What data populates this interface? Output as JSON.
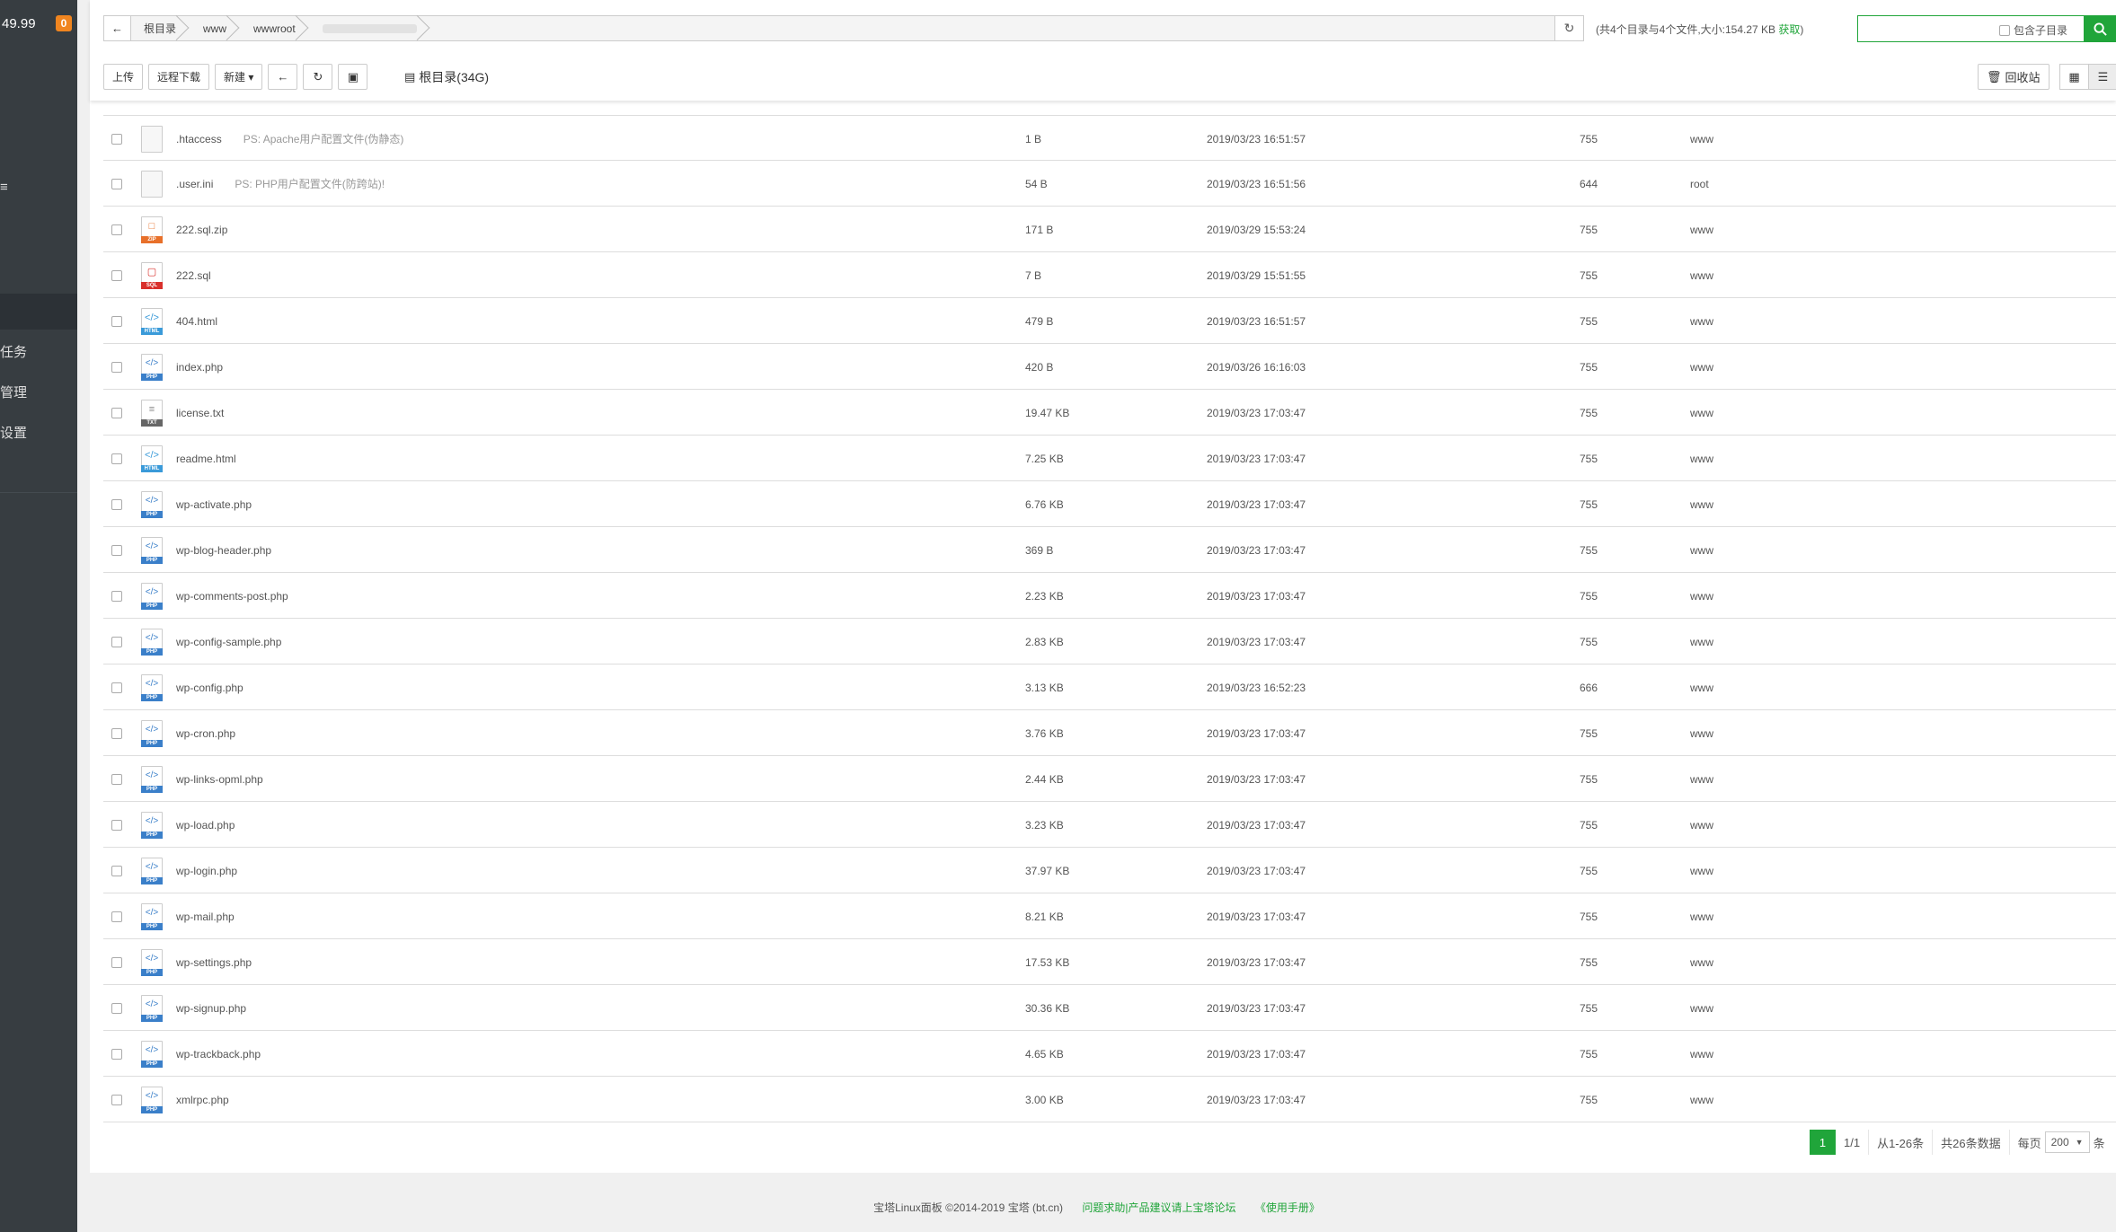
{
  "sidebar": {
    "top_text": "49.99",
    "badge": "0",
    "items": [
      {
        "label": "≡"
      },
      {
        "label": "任务"
      },
      {
        "label": "管理"
      },
      {
        "label": "设置"
      }
    ]
  },
  "header": {
    "breadcrumbs": [
      "根目录",
      "www",
      "wwwroot"
    ],
    "info_prefix": "(共4个目录与4个文件,大小:154.27 KB",
    "info_link": "获取",
    "info_suffix": ")",
    "search_value": "",
    "include_subdir_label": "包含子目录"
  },
  "toolbar": {
    "upload": "上传",
    "remote_download": "远程下载",
    "new": "新建 ▾",
    "disk": "根目录(34G)",
    "recycle": "回收站"
  },
  "files": [
    {
      "name": ".htaccess",
      "note": "PS: Apache用户配置文件(伪静态)",
      "size": "1 B",
      "time": "2019/03/23 16:51:57",
      "perm": "755",
      "owner": "www",
      "type": "blank"
    },
    {
      "name": ".user.ini",
      "note": "PS: PHP用户配置文件(防跨站)!",
      "size": "54 B",
      "time": "2019/03/23 16:51:56",
      "perm": "644",
      "owner": "root",
      "type": "blank"
    },
    {
      "name": "222.sql.zip",
      "note": "",
      "size": "171 B",
      "time": "2019/03/29 15:53:24",
      "perm": "755",
      "owner": "www",
      "type": "zip"
    },
    {
      "name": "222.sql",
      "note": "",
      "size": "7 B",
      "time": "2019/03/29 15:51:55",
      "perm": "755",
      "owner": "www",
      "type": "sql"
    },
    {
      "name": "404.html",
      "note": "",
      "size": "479 B",
      "time": "2019/03/23 16:51:57",
      "perm": "755",
      "owner": "www",
      "type": "html"
    },
    {
      "name": "index.php",
      "note": "",
      "size": "420 B",
      "time": "2019/03/26 16:16:03",
      "perm": "755",
      "owner": "www",
      "type": "php"
    },
    {
      "name": "license.txt",
      "note": "",
      "size": "19.47 KB",
      "time": "2019/03/23 17:03:47",
      "perm": "755",
      "owner": "www",
      "type": "txt"
    },
    {
      "name": "readme.html",
      "note": "",
      "size": "7.25 KB",
      "time": "2019/03/23 17:03:47",
      "perm": "755",
      "owner": "www",
      "type": "html"
    },
    {
      "name": "wp-activate.php",
      "note": "",
      "size": "6.76 KB",
      "time": "2019/03/23 17:03:47",
      "perm": "755",
      "owner": "www",
      "type": "php"
    },
    {
      "name": "wp-blog-header.php",
      "note": "",
      "size": "369 B",
      "time": "2019/03/23 17:03:47",
      "perm": "755",
      "owner": "www",
      "type": "php"
    },
    {
      "name": "wp-comments-post.php",
      "note": "",
      "size": "2.23 KB",
      "time": "2019/03/23 17:03:47",
      "perm": "755",
      "owner": "www",
      "type": "php"
    },
    {
      "name": "wp-config-sample.php",
      "note": "",
      "size": "2.83 KB",
      "time": "2019/03/23 17:03:47",
      "perm": "755",
      "owner": "www",
      "type": "php"
    },
    {
      "name": "wp-config.php",
      "note": "",
      "size": "3.13 KB",
      "time": "2019/03/23 16:52:23",
      "perm": "666",
      "owner": "www",
      "type": "php"
    },
    {
      "name": "wp-cron.php",
      "note": "",
      "size": "3.76 KB",
      "time": "2019/03/23 17:03:47",
      "perm": "755",
      "owner": "www",
      "type": "php"
    },
    {
      "name": "wp-links-opml.php",
      "note": "",
      "size": "2.44 KB",
      "time": "2019/03/23 17:03:47",
      "perm": "755",
      "owner": "www",
      "type": "php"
    },
    {
      "name": "wp-load.php",
      "note": "",
      "size": "3.23 KB",
      "time": "2019/03/23 17:03:47",
      "perm": "755",
      "owner": "www",
      "type": "php"
    },
    {
      "name": "wp-login.php",
      "note": "",
      "size": "37.97 KB",
      "time": "2019/03/23 17:03:47",
      "perm": "755",
      "owner": "www",
      "type": "php"
    },
    {
      "name": "wp-mail.php",
      "note": "",
      "size": "8.21 KB",
      "time": "2019/03/23 17:03:47",
      "perm": "755",
      "owner": "www",
      "type": "php"
    },
    {
      "name": "wp-settings.php",
      "note": "",
      "size": "17.53 KB",
      "time": "2019/03/23 17:03:47",
      "perm": "755",
      "owner": "www",
      "type": "php"
    },
    {
      "name": "wp-signup.php",
      "note": "",
      "size": "30.36 KB",
      "time": "2019/03/23 17:03:47",
      "perm": "755",
      "owner": "www",
      "type": "php"
    },
    {
      "name": "wp-trackback.php",
      "note": "",
      "size": "4.65 KB",
      "time": "2019/03/23 17:03:47",
      "perm": "755",
      "owner": "www",
      "type": "php"
    },
    {
      "name": "xmlrpc.php",
      "note": "",
      "size": "3.00 KB",
      "time": "2019/03/23 17:03:47",
      "perm": "755",
      "owner": "www",
      "type": "php"
    }
  ],
  "icon_labels": {
    "php": "PHP",
    "html": "HTML",
    "txt": "TXT",
    "zip": "ZIP",
    "sql": "SQL",
    "blank": ""
  },
  "pager": {
    "current": "1",
    "pages": "1/1",
    "range": "从1-26条",
    "total": "共26条数据",
    "per_page_label": "每页",
    "per_page": "200",
    "unit": "条"
  },
  "footer": {
    "copyright": "宝塔Linux面板 ©2014-2019 宝塔 (bt.cn)",
    "forum": "问题求助|产品建议请上宝塔论坛",
    "manual": "《使用手册》"
  },
  "colors": {
    "accent": "#20a53a",
    "sidebar": "#373d41",
    "badge": "#f0851f"
  }
}
